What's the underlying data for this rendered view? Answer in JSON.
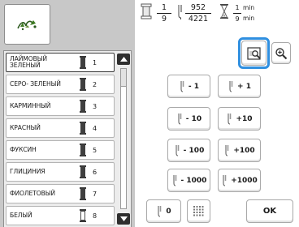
{
  "colors": [
    {
      "name": "ЛАЙМОВЫЙ\nЗЕЛЕНЫЙ",
      "num": "1",
      "light": false,
      "selected": true
    },
    {
      "name": "СЕРО- ЗЕЛЕНЫЙ",
      "num": "2",
      "light": false,
      "selected": false
    },
    {
      "name": "КАРМИННЫЙ",
      "num": "3",
      "light": false,
      "selected": false
    },
    {
      "name": "КРАСНЫЙ",
      "num": "4",
      "light": false,
      "selected": false
    },
    {
      "name": "ФУКСИН",
      "num": "5",
      "light": false,
      "selected": false
    },
    {
      "name": "ГЛИЦИНИЯ",
      "num": "6",
      "light": false,
      "selected": false
    },
    {
      "name": "ФИОЛЕТОВЫЙ",
      "num": "7",
      "light": false,
      "selected": false
    },
    {
      "name": "БЕЛЫЙ",
      "num": "8",
      "light": true,
      "selected": false
    }
  ],
  "status": {
    "color_current": "1",
    "color_total": "9",
    "stitch_current": "952",
    "stitch_total": "4221",
    "time_remaining": "1",
    "time_total": "9",
    "time_unit": "min"
  },
  "buttons": {
    "minus1": "- 1",
    "plus1": "+ 1",
    "minus10": "- 10",
    "plus10": "+10",
    "minus100": "- 100",
    "plus100": "+100",
    "minus1000": "- 1000",
    "plus1000": "+1000",
    "zero": "0",
    "ok": "OK"
  },
  "colors_theme": {
    "highlight": "#2f8fe0",
    "panel_bg": "#c8c8c8",
    "spool_dark": "#3f3f3f"
  }
}
